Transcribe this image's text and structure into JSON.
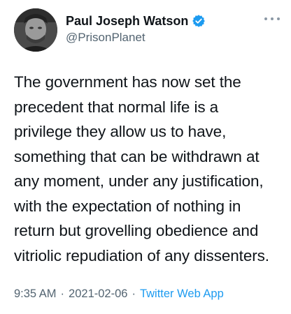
{
  "tweet": {
    "author": {
      "display_name": "Paul Joseph Watson",
      "handle": "@PrisonPlanet",
      "verified": true
    },
    "text": "The government has now set the\nprecedent that normal life is a\nprivilege they allow us to have,\nsomething that can be withdrawn at\nany moment, under any justification,\nwith the expectation of nothing in\nreturn but grovelling obedience and\nvitriolic repudiation of any dissenters.",
    "time": "9:35 AM",
    "date": "2021-02-06",
    "separator": "·",
    "source": "Twitter Web App",
    "more_icon": "more-horizontal-icon"
  },
  "colors": {
    "text": "#0f1419",
    "secondary": "#536471",
    "accent": "#1d9bf0"
  }
}
